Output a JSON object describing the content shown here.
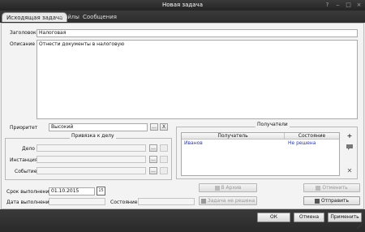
{
  "window": {
    "title": "Новая задача",
    "help_glyph": "?",
    "minimize_glyph": "‒",
    "maximize_glyph": "□",
    "close_glyph": "×"
  },
  "tabs": [
    {
      "label": "Исходящая задача",
      "active": true
    },
    {
      "label": "Файлы"
    },
    {
      "label": "Сообщения"
    }
  ],
  "form": {
    "title_label": "Заголовок",
    "title_value": "Налоговая",
    "description_label": "Описание",
    "description_value": "Отнести документы в налоговую",
    "priority_label": "Приоритет",
    "priority_value": "Высокий",
    "ellipsis": "...",
    "clear": "X"
  },
  "binding": {
    "title": "Привязка к делу",
    "case_label": "Дело",
    "instance_label": "Инстанция",
    "event_label": "Событие",
    "ellipsis": "...",
    "clear": "X"
  },
  "recipients": {
    "title": "Получатели",
    "columns": [
      "Получатель",
      "Состояние"
    ],
    "rows": [
      {
        "recipient": "Иванов",
        "status": "Не решена"
      }
    ],
    "add_glyph": "+",
    "remove_glyph": "✕"
  },
  "schedule": {
    "due_label": "Срок выполнения",
    "due_value": "01.10.2015",
    "calendar_num": "15",
    "done_label": "Дата выполнения",
    "state_label": "Состояние"
  },
  "actions": {
    "archive": "В Архив",
    "unsolved": "Задача не решена",
    "cancel_task": "Отменить",
    "send": "Отправить"
  },
  "footer": {
    "ok": "ОК",
    "cancel": "Отмена",
    "apply": "Применить"
  },
  "colors": {
    "accent_link": "#2a3aa0",
    "titlebar": "#2d2d2d"
  }
}
